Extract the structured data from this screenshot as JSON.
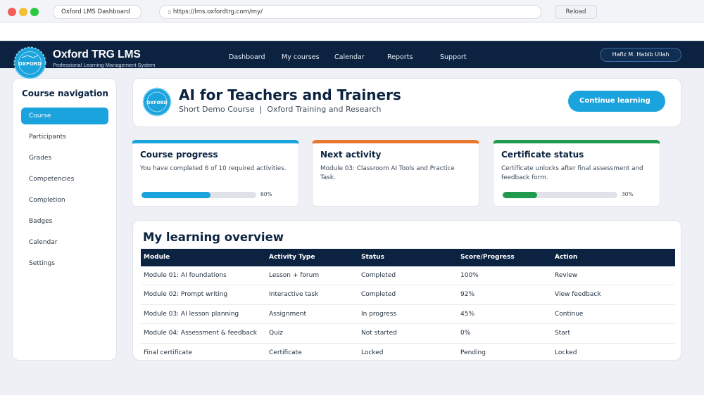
{
  "browser": {
    "tab_title": "Oxford LMS Dashboard",
    "url": "https://lms.oxfordtrg.com/my/",
    "lock_icon": "lock-icon",
    "reload_label": "Reload"
  },
  "header": {
    "logo_text": "OXFORD",
    "brand_title": "Oxford TRG LMS",
    "brand_subtitle": "Professional Learning Management System",
    "nav": [
      "Dashboard",
      "My courses",
      "Calendar",
      "Reports",
      "Support"
    ],
    "user": "Hafiz M. Habib Ullah"
  },
  "sidebar": {
    "title": "Course navigation",
    "items": [
      "Course",
      "Participants",
      "Grades",
      "Competencies",
      "Completion",
      "Badges",
      "Calendar",
      "Settings"
    ],
    "active_index": 0
  },
  "course": {
    "logo_text": "OXFORD",
    "title": "AI for Teachers and Trainers",
    "subtitle": "Short Demo Course  |  Oxford Training and Research",
    "continue_label": "Continue learning"
  },
  "stats": {
    "progress": {
      "title": "Course progress",
      "text": "You have completed 6 of 10 required activities.",
      "value": 60,
      "value_label": "60%",
      "color": "#1aa3dc"
    },
    "next": {
      "title": "Next activity",
      "text": "Module 03: Classroom AI Tools and Practice Task.",
      "color": "#e8782e"
    },
    "certificate": {
      "title": "Certificate status",
      "text": "Certificate unlocks after final assessment and feedback form.",
      "value": 30,
      "value_label": "30%",
      "color": "#1f9a4e"
    }
  },
  "overview": {
    "title": "My learning overview",
    "columns": [
      "Module",
      "Activity Type",
      "Status",
      "Score/Progress",
      "Action"
    ],
    "rows": [
      [
        "Module 01: AI foundations",
        "Lesson + forum",
        "Completed",
        "100%",
        "Review"
      ],
      [
        "Module 02: Prompt writing",
        "Interactive task",
        "Completed",
        "92%",
        "View feedback"
      ],
      [
        "Module 03: AI lesson planning",
        "Assignment",
        "In progress",
        "45%",
        "Continue"
      ],
      [
        "Module 04: Assessment & feedback",
        "Quiz",
        "Not started",
        "0%",
        "Start"
      ],
      [
        "Final certificate",
        "Certificate",
        "Locked",
        "Pending",
        "Locked"
      ]
    ]
  }
}
